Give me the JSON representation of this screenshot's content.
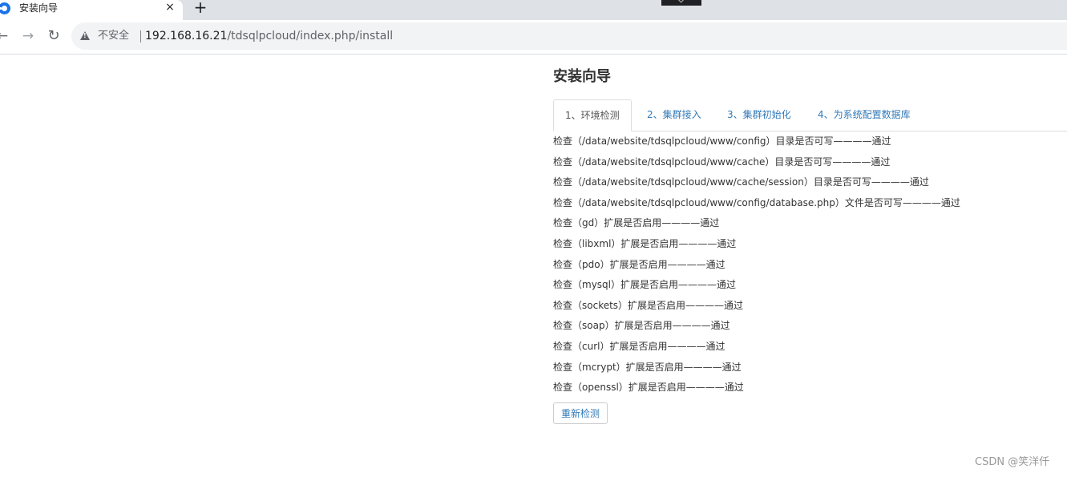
{
  "browser": {
    "tab_title": "安装向导",
    "tab_close": "×",
    "new_tab": "+",
    "security_label": "不安全",
    "url_host": "192.168.16.21",
    "url_path": "/tdsqlpcloud/index.php/install"
  },
  "page": {
    "title": "安装向导",
    "tabs": [
      {
        "label": "1、环境检测",
        "active": true
      },
      {
        "label": "2、集群接入",
        "active": false
      },
      {
        "label": "3、集群初始化",
        "active": false
      },
      {
        "label": "4、为系统配置数据库",
        "active": false
      }
    ],
    "checks": [
      "检查（/data/website/tdsqlpcloud/www/config）目录是否可写————通过",
      "检查（/data/website/tdsqlpcloud/www/cache）目录是否可写————通过",
      "检查（/data/website/tdsqlpcloud/www/cache/session）目录是否可写————通过",
      "检查（/data/website/tdsqlpcloud/www/config/database.php）文件是否可写————通过",
      "检查（gd）扩展是否启用————通过",
      "检查（libxml）扩展是否启用————通过",
      "检查（pdo）扩展是否启用————通过",
      "检查（mysql）扩展是否启用————通过",
      "检查（sockets）扩展是否启用————通过",
      "检查（soap）扩展是否启用————通过",
      "检查（curl）扩展是否启用————通过",
      "检查（mcrypt）扩展是否启用————通过",
      "检查（openssl）扩展是否启用————通过"
    ],
    "recheck_label": "重新检测"
  },
  "watermark": "CSDN @笑洋仟"
}
